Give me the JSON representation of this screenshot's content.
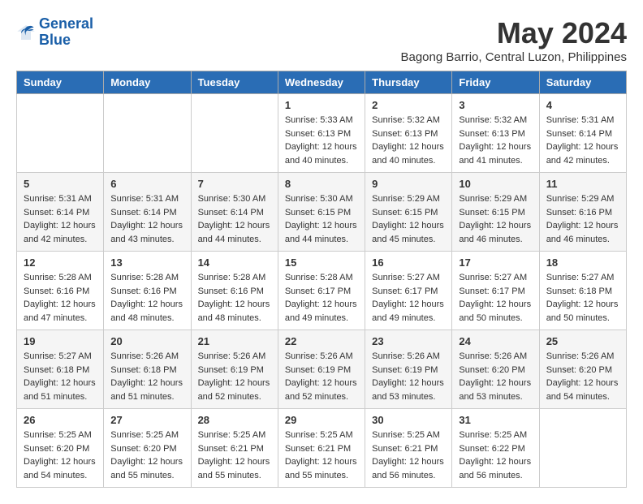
{
  "header": {
    "logo_line1": "General",
    "logo_line2": "Blue",
    "month": "May 2024",
    "location": "Bagong Barrio, Central Luzon, Philippines"
  },
  "weekdays": [
    "Sunday",
    "Monday",
    "Tuesday",
    "Wednesday",
    "Thursday",
    "Friday",
    "Saturday"
  ],
  "weeks": [
    [
      {
        "day": "",
        "sunrise": "",
        "sunset": "",
        "daylight": ""
      },
      {
        "day": "",
        "sunrise": "",
        "sunset": "",
        "daylight": ""
      },
      {
        "day": "",
        "sunrise": "",
        "sunset": "",
        "daylight": ""
      },
      {
        "day": "1",
        "sunrise": "Sunrise: 5:33 AM",
        "sunset": "Sunset: 6:13 PM",
        "daylight": "Daylight: 12 hours and 40 minutes."
      },
      {
        "day": "2",
        "sunrise": "Sunrise: 5:32 AM",
        "sunset": "Sunset: 6:13 PM",
        "daylight": "Daylight: 12 hours and 40 minutes."
      },
      {
        "day": "3",
        "sunrise": "Sunrise: 5:32 AM",
        "sunset": "Sunset: 6:13 PM",
        "daylight": "Daylight: 12 hours and 41 minutes."
      },
      {
        "day": "4",
        "sunrise": "Sunrise: 5:31 AM",
        "sunset": "Sunset: 6:14 PM",
        "daylight": "Daylight: 12 hours and 42 minutes."
      }
    ],
    [
      {
        "day": "5",
        "sunrise": "Sunrise: 5:31 AM",
        "sunset": "Sunset: 6:14 PM",
        "daylight": "Daylight: 12 hours and 42 minutes."
      },
      {
        "day": "6",
        "sunrise": "Sunrise: 5:31 AM",
        "sunset": "Sunset: 6:14 PM",
        "daylight": "Daylight: 12 hours and 43 minutes."
      },
      {
        "day": "7",
        "sunrise": "Sunrise: 5:30 AM",
        "sunset": "Sunset: 6:14 PM",
        "daylight": "Daylight: 12 hours and 44 minutes."
      },
      {
        "day": "8",
        "sunrise": "Sunrise: 5:30 AM",
        "sunset": "Sunset: 6:15 PM",
        "daylight": "Daylight: 12 hours and 44 minutes."
      },
      {
        "day": "9",
        "sunrise": "Sunrise: 5:29 AM",
        "sunset": "Sunset: 6:15 PM",
        "daylight": "Daylight: 12 hours and 45 minutes."
      },
      {
        "day": "10",
        "sunrise": "Sunrise: 5:29 AM",
        "sunset": "Sunset: 6:15 PM",
        "daylight": "Daylight: 12 hours and 46 minutes."
      },
      {
        "day": "11",
        "sunrise": "Sunrise: 5:29 AM",
        "sunset": "Sunset: 6:16 PM",
        "daylight": "Daylight: 12 hours and 46 minutes."
      }
    ],
    [
      {
        "day": "12",
        "sunrise": "Sunrise: 5:28 AM",
        "sunset": "Sunset: 6:16 PM",
        "daylight": "Daylight: 12 hours and 47 minutes."
      },
      {
        "day": "13",
        "sunrise": "Sunrise: 5:28 AM",
        "sunset": "Sunset: 6:16 PM",
        "daylight": "Daylight: 12 hours and 48 minutes."
      },
      {
        "day": "14",
        "sunrise": "Sunrise: 5:28 AM",
        "sunset": "Sunset: 6:16 PM",
        "daylight": "Daylight: 12 hours and 48 minutes."
      },
      {
        "day": "15",
        "sunrise": "Sunrise: 5:28 AM",
        "sunset": "Sunset: 6:17 PM",
        "daylight": "Daylight: 12 hours and 49 minutes."
      },
      {
        "day": "16",
        "sunrise": "Sunrise: 5:27 AM",
        "sunset": "Sunset: 6:17 PM",
        "daylight": "Daylight: 12 hours and 49 minutes."
      },
      {
        "day": "17",
        "sunrise": "Sunrise: 5:27 AM",
        "sunset": "Sunset: 6:17 PM",
        "daylight": "Daylight: 12 hours and 50 minutes."
      },
      {
        "day": "18",
        "sunrise": "Sunrise: 5:27 AM",
        "sunset": "Sunset: 6:18 PM",
        "daylight": "Daylight: 12 hours and 50 minutes."
      }
    ],
    [
      {
        "day": "19",
        "sunrise": "Sunrise: 5:27 AM",
        "sunset": "Sunset: 6:18 PM",
        "daylight": "Daylight: 12 hours and 51 minutes."
      },
      {
        "day": "20",
        "sunrise": "Sunrise: 5:26 AM",
        "sunset": "Sunset: 6:18 PM",
        "daylight": "Daylight: 12 hours and 51 minutes."
      },
      {
        "day": "21",
        "sunrise": "Sunrise: 5:26 AM",
        "sunset": "Sunset: 6:19 PM",
        "daylight": "Daylight: 12 hours and 52 minutes."
      },
      {
        "day": "22",
        "sunrise": "Sunrise: 5:26 AM",
        "sunset": "Sunset: 6:19 PM",
        "daylight": "Daylight: 12 hours and 52 minutes."
      },
      {
        "day": "23",
        "sunrise": "Sunrise: 5:26 AM",
        "sunset": "Sunset: 6:19 PM",
        "daylight": "Daylight: 12 hours and 53 minutes."
      },
      {
        "day": "24",
        "sunrise": "Sunrise: 5:26 AM",
        "sunset": "Sunset: 6:20 PM",
        "daylight": "Daylight: 12 hours and 53 minutes."
      },
      {
        "day": "25",
        "sunrise": "Sunrise: 5:26 AM",
        "sunset": "Sunset: 6:20 PM",
        "daylight": "Daylight: 12 hours and 54 minutes."
      }
    ],
    [
      {
        "day": "26",
        "sunrise": "Sunrise: 5:25 AM",
        "sunset": "Sunset: 6:20 PM",
        "daylight": "Daylight: 12 hours and 54 minutes."
      },
      {
        "day": "27",
        "sunrise": "Sunrise: 5:25 AM",
        "sunset": "Sunset: 6:20 PM",
        "daylight": "Daylight: 12 hours and 55 minutes."
      },
      {
        "day": "28",
        "sunrise": "Sunrise: 5:25 AM",
        "sunset": "Sunset: 6:21 PM",
        "daylight": "Daylight: 12 hours and 55 minutes."
      },
      {
        "day": "29",
        "sunrise": "Sunrise: 5:25 AM",
        "sunset": "Sunset: 6:21 PM",
        "daylight": "Daylight: 12 hours and 55 minutes."
      },
      {
        "day": "30",
        "sunrise": "Sunrise: 5:25 AM",
        "sunset": "Sunset: 6:21 PM",
        "daylight": "Daylight: 12 hours and 56 minutes."
      },
      {
        "day": "31",
        "sunrise": "Sunrise: 5:25 AM",
        "sunset": "Sunset: 6:22 PM",
        "daylight": "Daylight: 12 hours and 56 minutes."
      },
      {
        "day": "",
        "sunrise": "",
        "sunset": "",
        "daylight": ""
      }
    ]
  ]
}
